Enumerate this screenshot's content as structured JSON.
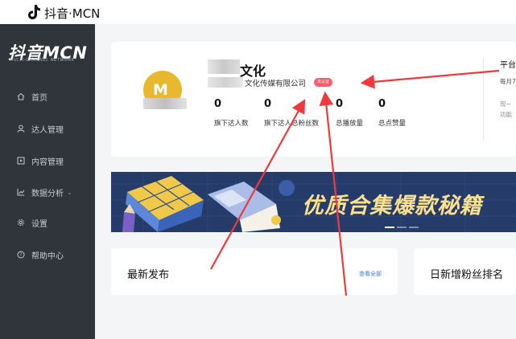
{
  "header": {
    "title": "抖音·MCN",
    "logo_icon": "tiktok-icon"
  },
  "sidebar": {
    "brand": "抖音MCN",
    "brand_sub": "MULTI-CHANNEL NETWORK",
    "items": [
      {
        "label": "首页",
        "icon": "home-icon"
      },
      {
        "label": "达人管理",
        "icon": "user-icon"
      },
      {
        "label": "内容管理",
        "icon": "content-icon"
      },
      {
        "label": "数据分析",
        "icon": "chart-icon",
        "chevron": "⌄"
      },
      {
        "label": "设置",
        "icon": "gear-icon"
      },
      {
        "label": "帮助中心",
        "icon": "help-icon"
      }
    ]
  },
  "profile": {
    "avatar_letter": "M",
    "name": "文化",
    "company": "文化传媒有限公司",
    "badge": "未认证",
    "stats": [
      {
        "value": "0",
        "label": "旗下达人数"
      },
      {
        "value": "0",
        "label": "旗下达人总粉丝数"
      },
      {
        "value": "0",
        "label": "总播放量"
      },
      {
        "value": "0",
        "label": "总点赞量"
      }
    ],
    "side": {
      "title": "平台",
      "line1": "每月7",
      "line2": "现~",
      "line3": "功能"
    }
  },
  "banner": {
    "text": "优质合集爆款秘籍"
  },
  "panels": {
    "latest": {
      "title": "最新发布",
      "link": "查看全部"
    },
    "ranking": {
      "title": "日新增粉丝排名"
    }
  },
  "colors": {
    "sidebar": "#2f353b",
    "accent_badge": "#ff5c6a",
    "banner_bg": "#253c6a",
    "annotation": "#f0393c"
  }
}
